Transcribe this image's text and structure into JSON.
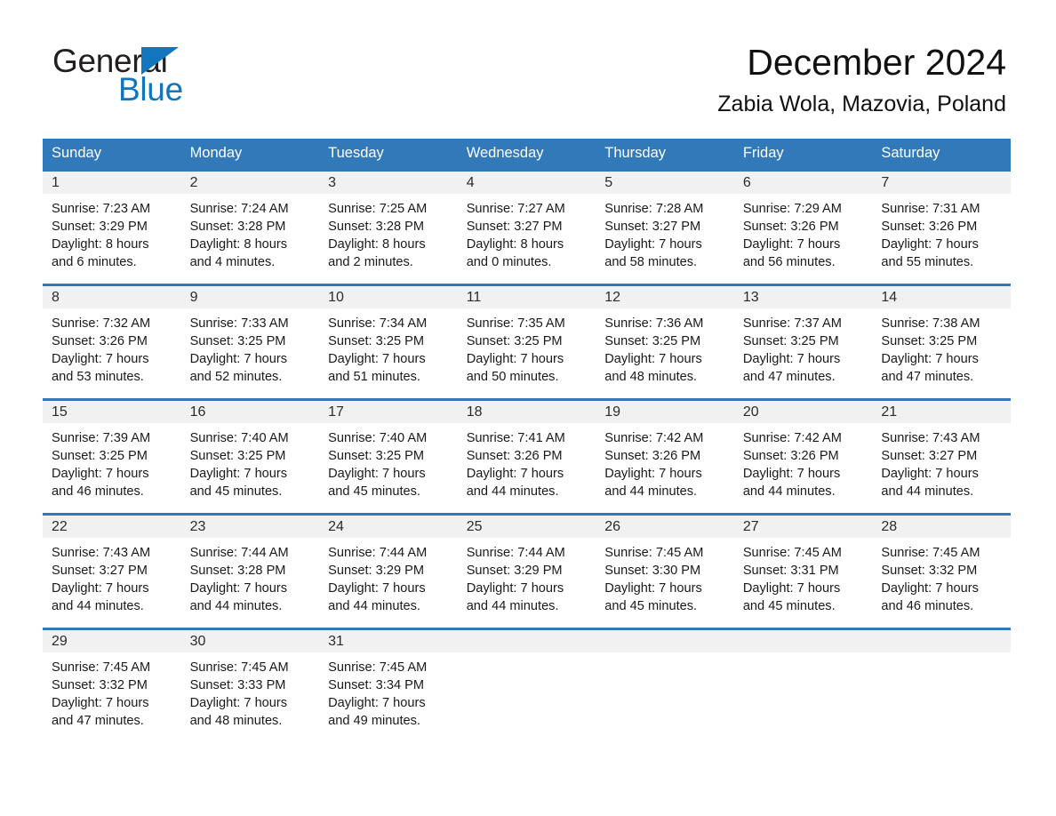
{
  "brand": {
    "name_part1": "General",
    "name_part2": "Blue",
    "flag_icon": "triangle-flag-icon"
  },
  "header": {
    "month_title": "December 2024",
    "location": "Zabia Wola, Mazovia, Poland"
  },
  "colors": {
    "header_blue": "#3179b8",
    "brand_blue": "#1275bd",
    "daynum_bg": "#f1f1f1",
    "text": "#1a1a1a"
  },
  "weekdays": [
    "Sunday",
    "Monday",
    "Tuesday",
    "Wednesday",
    "Thursday",
    "Friday",
    "Saturday"
  ],
  "weeks": [
    [
      {
        "day": "1",
        "sunrise": "Sunrise: 7:23 AM",
        "sunset": "Sunset: 3:29 PM",
        "daylight1": "Daylight: 8 hours",
        "daylight2": "and 6 minutes."
      },
      {
        "day": "2",
        "sunrise": "Sunrise: 7:24 AM",
        "sunset": "Sunset: 3:28 PM",
        "daylight1": "Daylight: 8 hours",
        "daylight2": "and 4 minutes."
      },
      {
        "day": "3",
        "sunrise": "Sunrise: 7:25 AM",
        "sunset": "Sunset: 3:28 PM",
        "daylight1": "Daylight: 8 hours",
        "daylight2": "and 2 minutes."
      },
      {
        "day": "4",
        "sunrise": "Sunrise: 7:27 AM",
        "sunset": "Sunset: 3:27 PM",
        "daylight1": "Daylight: 8 hours",
        "daylight2": "and 0 minutes."
      },
      {
        "day": "5",
        "sunrise": "Sunrise: 7:28 AM",
        "sunset": "Sunset: 3:27 PM",
        "daylight1": "Daylight: 7 hours",
        "daylight2": "and 58 minutes."
      },
      {
        "day": "6",
        "sunrise": "Sunrise: 7:29 AM",
        "sunset": "Sunset: 3:26 PM",
        "daylight1": "Daylight: 7 hours",
        "daylight2": "and 56 minutes."
      },
      {
        "day": "7",
        "sunrise": "Sunrise: 7:31 AM",
        "sunset": "Sunset: 3:26 PM",
        "daylight1": "Daylight: 7 hours",
        "daylight2": "and 55 minutes."
      }
    ],
    [
      {
        "day": "8",
        "sunrise": "Sunrise: 7:32 AM",
        "sunset": "Sunset: 3:26 PM",
        "daylight1": "Daylight: 7 hours",
        "daylight2": "and 53 minutes."
      },
      {
        "day": "9",
        "sunrise": "Sunrise: 7:33 AM",
        "sunset": "Sunset: 3:25 PM",
        "daylight1": "Daylight: 7 hours",
        "daylight2": "and 52 minutes."
      },
      {
        "day": "10",
        "sunrise": "Sunrise: 7:34 AM",
        "sunset": "Sunset: 3:25 PM",
        "daylight1": "Daylight: 7 hours",
        "daylight2": "and 51 minutes."
      },
      {
        "day": "11",
        "sunrise": "Sunrise: 7:35 AM",
        "sunset": "Sunset: 3:25 PM",
        "daylight1": "Daylight: 7 hours",
        "daylight2": "and 50 minutes."
      },
      {
        "day": "12",
        "sunrise": "Sunrise: 7:36 AM",
        "sunset": "Sunset: 3:25 PM",
        "daylight1": "Daylight: 7 hours",
        "daylight2": "and 48 minutes."
      },
      {
        "day": "13",
        "sunrise": "Sunrise: 7:37 AM",
        "sunset": "Sunset: 3:25 PM",
        "daylight1": "Daylight: 7 hours",
        "daylight2": "and 47 minutes."
      },
      {
        "day": "14",
        "sunrise": "Sunrise: 7:38 AM",
        "sunset": "Sunset: 3:25 PM",
        "daylight1": "Daylight: 7 hours",
        "daylight2": "and 47 minutes."
      }
    ],
    [
      {
        "day": "15",
        "sunrise": "Sunrise: 7:39 AM",
        "sunset": "Sunset: 3:25 PM",
        "daylight1": "Daylight: 7 hours",
        "daylight2": "and 46 minutes."
      },
      {
        "day": "16",
        "sunrise": "Sunrise: 7:40 AM",
        "sunset": "Sunset: 3:25 PM",
        "daylight1": "Daylight: 7 hours",
        "daylight2": "and 45 minutes."
      },
      {
        "day": "17",
        "sunrise": "Sunrise: 7:40 AM",
        "sunset": "Sunset: 3:25 PM",
        "daylight1": "Daylight: 7 hours",
        "daylight2": "and 45 minutes."
      },
      {
        "day": "18",
        "sunrise": "Sunrise: 7:41 AM",
        "sunset": "Sunset: 3:26 PM",
        "daylight1": "Daylight: 7 hours",
        "daylight2": "and 44 minutes."
      },
      {
        "day": "19",
        "sunrise": "Sunrise: 7:42 AM",
        "sunset": "Sunset: 3:26 PM",
        "daylight1": "Daylight: 7 hours",
        "daylight2": "and 44 minutes."
      },
      {
        "day": "20",
        "sunrise": "Sunrise: 7:42 AM",
        "sunset": "Sunset: 3:26 PM",
        "daylight1": "Daylight: 7 hours",
        "daylight2": "and 44 minutes."
      },
      {
        "day": "21",
        "sunrise": "Sunrise: 7:43 AM",
        "sunset": "Sunset: 3:27 PM",
        "daylight1": "Daylight: 7 hours",
        "daylight2": "and 44 minutes."
      }
    ],
    [
      {
        "day": "22",
        "sunrise": "Sunrise: 7:43 AM",
        "sunset": "Sunset: 3:27 PM",
        "daylight1": "Daylight: 7 hours",
        "daylight2": "and 44 minutes."
      },
      {
        "day": "23",
        "sunrise": "Sunrise: 7:44 AM",
        "sunset": "Sunset: 3:28 PM",
        "daylight1": "Daylight: 7 hours",
        "daylight2": "and 44 minutes."
      },
      {
        "day": "24",
        "sunrise": "Sunrise: 7:44 AM",
        "sunset": "Sunset: 3:29 PM",
        "daylight1": "Daylight: 7 hours",
        "daylight2": "and 44 minutes."
      },
      {
        "day": "25",
        "sunrise": "Sunrise: 7:44 AM",
        "sunset": "Sunset: 3:29 PM",
        "daylight1": "Daylight: 7 hours",
        "daylight2": "and 44 minutes."
      },
      {
        "day": "26",
        "sunrise": "Sunrise: 7:45 AM",
        "sunset": "Sunset: 3:30 PM",
        "daylight1": "Daylight: 7 hours",
        "daylight2": "and 45 minutes."
      },
      {
        "day": "27",
        "sunrise": "Sunrise: 7:45 AM",
        "sunset": "Sunset: 3:31 PM",
        "daylight1": "Daylight: 7 hours",
        "daylight2": "and 45 minutes."
      },
      {
        "day": "28",
        "sunrise": "Sunrise: 7:45 AM",
        "sunset": "Sunset: 3:32 PM",
        "daylight1": "Daylight: 7 hours",
        "daylight2": "and 46 minutes."
      }
    ],
    [
      {
        "day": "29",
        "sunrise": "Sunrise: 7:45 AM",
        "sunset": "Sunset: 3:32 PM",
        "daylight1": "Daylight: 7 hours",
        "daylight2": "and 47 minutes."
      },
      {
        "day": "30",
        "sunrise": "Sunrise: 7:45 AM",
        "sunset": "Sunset: 3:33 PM",
        "daylight1": "Daylight: 7 hours",
        "daylight2": "and 48 minutes."
      },
      {
        "day": "31",
        "sunrise": "Sunrise: 7:45 AM",
        "sunset": "Sunset: 3:34 PM",
        "daylight1": "Daylight: 7 hours",
        "daylight2": "and 49 minutes."
      },
      {
        "day": "",
        "sunrise": "",
        "sunset": "",
        "daylight1": "",
        "daylight2": ""
      },
      {
        "day": "",
        "sunrise": "",
        "sunset": "",
        "daylight1": "",
        "daylight2": ""
      },
      {
        "day": "",
        "sunrise": "",
        "sunset": "",
        "daylight1": "",
        "daylight2": ""
      },
      {
        "day": "",
        "sunrise": "",
        "sunset": "",
        "daylight1": "",
        "daylight2": ""
      }
    ]
  ]
}
